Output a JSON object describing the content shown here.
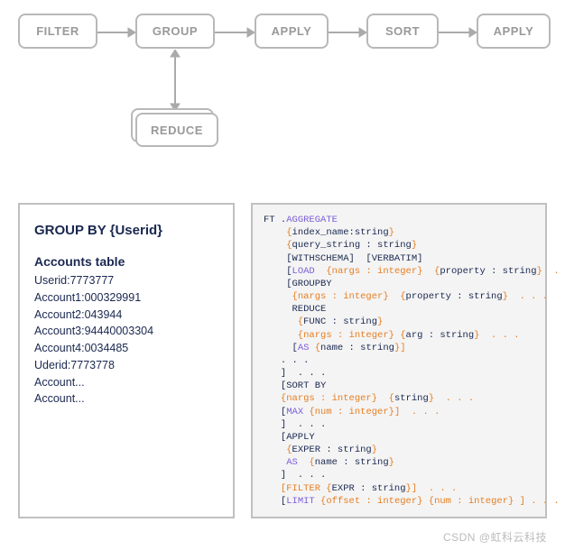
{
  "flow": {
    "filter": "FILTER",
    "group": "GROUP",
    "apply1": "APPLY",
    "sort": "SORT",
    "apply2": "APPLY",
    "reduce": "REDUCE"
  },
  "left_panel": {
    "title": "GROUP BY {Userid}",
    "subtitle": "Accounts table",
    "rows": [
      "Userid:7773777",
      "Account1:000329991",
      "Account2:043944",
      "Account3:94440003304",
      "Account4:0034485",
      "Uderid:7773778",
      "Account...",
      "Account..."
    ]
  },
  "code": {
    "l1a": "FT .",
    "l1b": "AGGREGATE",
    "l2a": "    {",
    "l2b": "index_name:string",
    "l2c": "}",
    "l3a": "    {",
    "l3b": "query_string : string",
    "l3c": "}",
    "l4": "    [WITHSCHEMA]  [VERBATIM]",
    "l5a": "    [",
    "l5b": "LOAD",
    "l5c": "  {",
    "l5d": "nargs : integer",
    "l5e": "}  {",
    "l5f": "property : string",
    "l5g": "}  . . . ]",
    "l6": "    [GROUPBY",
    "l7a": "     {",
    "l7b": "nargs : integer",
    "l7c": "}  {",
    "l7d": "property : string",
    "l7e": "}  . . .",
    "l8": "     REDUCE",
    "l9a": "      {",
    "l9b": "FUNC : string",
    "l9c": "}",
    "l10a": "      {",
    "l10b": "nargs : integer",
    "l10c": "} {",
    "l10d": "arg : string",
    "l10e": "}  . . .",
    "l11a": "     [",
    "l11b": "AS",
    "l11c": " {",
    "l11d": "name : string",
    "l11e": "}]",
    "l12": "   . . .",
    "l13": "   ]  . . .",
    "l14": "   [SORT BY",
    "l15a": "   {",
    "l15b": "nargs : integer",
    "l15c": "}  {",
    "l15d": "string",
    "l15e": "}  . . .",
    "l16a": "   [",
    "l16b": "MAX",
    "l16c": " {",
    "l16d": "num : integer",
    "l16e": "}]  . . .",
    "l17": "   ]  . . .",
    "l18": "   [APPLY",
    "l19a": "    {",
    "l19b": "EXPER : string",
    "l19c": "}",
    "l20a": "    ",
    "l20b": "AS",
    "l20c": "  {",
    "l20d": "name : string",
    "l20e": "}",
    "l21": "   ]  . . .",
    "l22a": "   [FILTER {",
    "l22b": "EXPR : string",
    "l22c": "}]  . . .",
    "l23a": "   [",
    "l23b": "LIMIT",
    "l23c": " {",
    "l23d": "offset : integer",
    "l23e": "} {",
    "l23f": "num : integer",
    "l23g": "} ] . . ."
  },
  "watermark": "CSDN @虹科云科技"
}
